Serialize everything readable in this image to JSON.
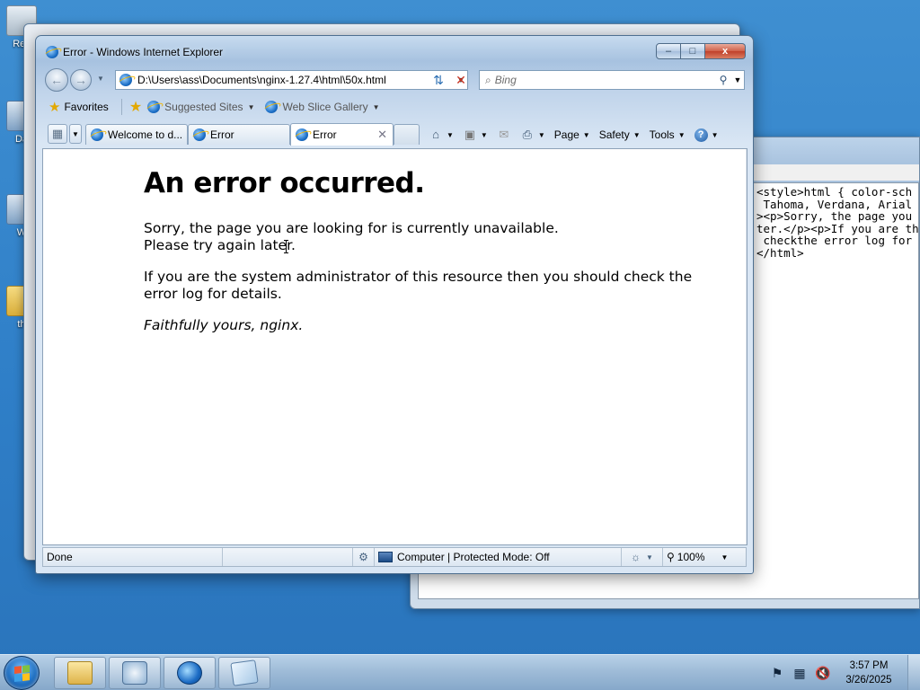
{
  "desktop": {
    "icons": [
      {
        "label": "Rec"
      },
      {
        "label": "Da"
      },
      {
        "label": "W"
      },
      {
        "label": "th"
      }
    ]
  },
  "notepad": {
    "code_lines": [
      "<style>html { color-sch",
      " Tahoma, Verdana, Arial",
      "><p>Sorry, the page you",
      "ter.</p><p>If you are th",
      " checkthe error log for",
      "</html>"
    ]
  },
  "ie": {
    "title": "Error - Windows Internet Explorer",
    "window_buttons": {
      "minimize": "–",
      "maximize": "□",
      "close": "x"
    },
    "address": {
      "url": "D:\\Users\\ass\\Documents\\nginx-1.27.4\\html\\50x.html"
    },
    "search": {
      "placeholder": "Bing"
    },
    "favorites_bar": {
      "favorites_label": "Favorites",
      "suggested_sites": "Suggested Sites",
      "web_slice_gallery": "Web Slice Gallery"
    },
    "tabs": [
      {
        "label": "Welcome to d..."
      },
      {
        "label": "Error"
      },
      {
        "label": "Error",
        "active": true
      }
    ],
    "command_bar": {
      "page": "Page",
      "safety": "Safety",
      "tools": "Tools"
    },
    "page": {
      "heading": "An error occurred.",
      "para1_line1": "Sorry, the page you are looking for is currently unavailable.",
      "para1_line2": "Please try again later.",
      "para2_line1": "If you are the system administrator of this resource then you should check the",
      "para2_line2": "error log for details.",
      "signature": "Faithfully yours, nginx."
    },
    "status_bar": {
      "status": "Done",
      "zone": "Computer | Protected Mode: Off",
      "zoom": "100%"
    }
  },
  "taskbar": {
    "clock_time": "3:57 PM",
    "clock_date": "3/26/2025"
  },
  "colors": {
    "desktop": "#3a88cc",
    "close_button": "#c8432c",
    "accent": "#1c6fc7"
  }
}
